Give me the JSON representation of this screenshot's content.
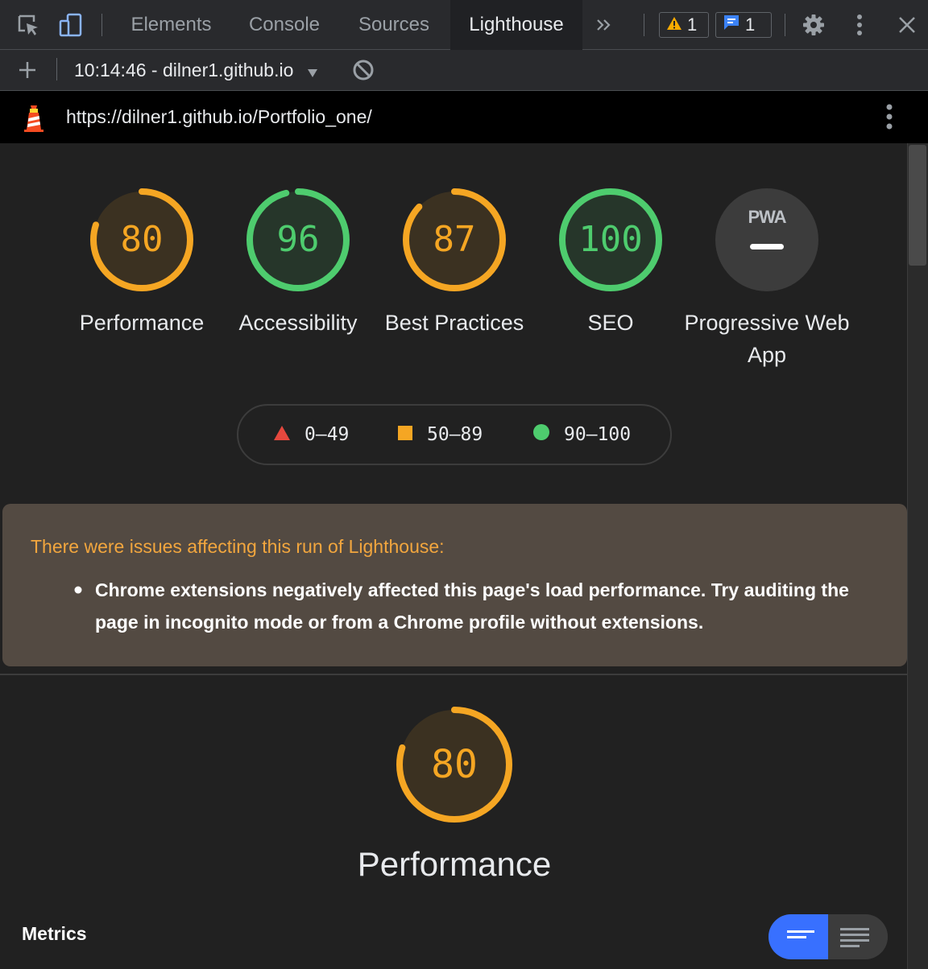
{
  "devtools": {
    "tabs": [
      {
        "label": "Elements"
      },
      {
        "label": "Console"
      },
      {
        "label": "Sources"
      },
      {
        "label": "Lighthouse",
        "active": true
      }
    ],
    "more_tabs_icon": "chevron-double-right-icon",
    "warnings_count": "1",
    "messages_count": "1"
  },
  "report_toolbar": {
    "selected_report": "10:14:46 - dilner1.github.io"
  },
  "url_bar": {
    "url": "https://dilner1.github.io/Portfolio_one/"
  },
  "scores": [
    {
      "label": "Performance",
      "value": "80",
      "fraction": 0.8,
      "color": "#f5a623"
    },
    {
      "label": "Accessibility",
      "value": "96",
      "fraction": 0.96,
      "color": "#4ecc6e"
    },
    {
      "label": "Best Practices",
      "value": "87",
      "fraction": 0.87,
      "color": "#f5a623"
    },
    {
      "label": "SEO",
      "value": "100",
      "fraction": 1.0,
      "color": "#4ecc6e"
    },
    {
      "label": "Progressive Web App",
      "value": "",
      "badge": "PWA"
    }
  ],
  "legend": [
    {
      "shape": "triangle",
      "range": "0–49",
      "color": "#e5483e"
    },
    {
      "shape": "square",
      "range": "50–89",
      "color": "#f5a623"
    },
    {
      "shape": "circle",
      "range": "90–100",
      "color": "#4ecc6e"
    }
  ],
  "warning": {
    "title": "There were issues affecting this run of Lighthouse:",
    "items": [
      "Chrome extensions negatively affected this page's load performance. Try auditing the page in incognito mode or from a Chrome profile without extensions."
    ]
  },
  "performance_section": {
    "score": "80",
    "fraction": 0.8,
    "title": "Performance",
    "metrics_label": "Metrics"
  }
}
